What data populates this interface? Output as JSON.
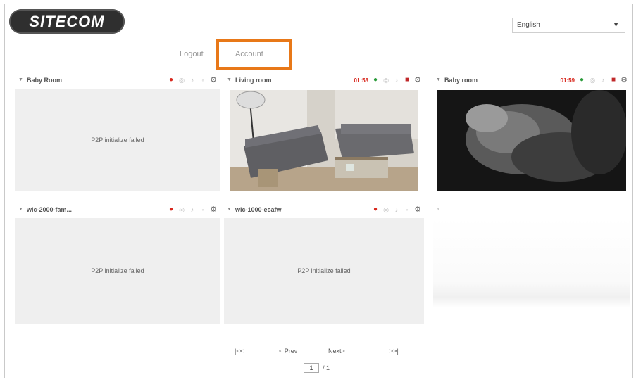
{
  "brand": {
    "logo_text": "SITECOM"
  },
  "language": {
    "selected": "English"
  },
  "nav": {
    "logout_label": "Logout",
    "account_label": "Account"
  },
  "cameras": [
    {
      "name": "Baby Room",
      "time": "",
      "status": "P2P initialize failed"
    },
    {
      "name": "Living room",
      "time": "01:58",
      "status": ""
    },
    {
      "name": "Baby room",
      "time": "01:59",
      "status": ""
    },
    {
      "name": "wlc-2000-fam...",
      "time": "",
      "status": "P2P initialize failed"
    },
    {
      "name": "wlc-1000-ecafw",
      "time": "",
      "status": "P2P initialize failed"
    }
  ],
  "pager": {
    "first": "|<<",
    "prev": "< Prev",
    "next": "Next>",
    "last": ">>|",
    "current_page": "1",
    "total_pages": "/ 1"
  },
  "icons": {
    "record": "record-icon",
    "live": "live-icon",
    "snapshot": "camera-icon",
    "audio": "speaker-icon",
    "settings": "gear-icon"
  },
  "colors": {
    "highlight": "#e87818",
    "record": "#d8281e",
    "live": "#2a9b3a",
    "logo_bg": "#2f2f2f"
  }
}
